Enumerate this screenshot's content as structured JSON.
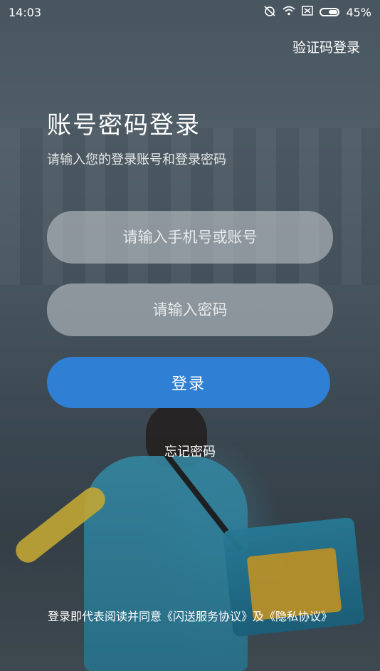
{
  "status_bar": {
    "time": "14:03",
    "icons": [
      "alarm-off-icon",
      "wifi-icon",
      "sim-off-icon",
      "battery-icon"
    ],
    "battery": "45%"
  },
  "header": {
    "switch_login_label": "验证码登录"
  },
  "main": {
    "title": "账号密码登录",
    "subtitle": "请输入您的登录账号和登录密码",
    "account_placeholder": "请输入手机号或账号",
    "password_placeholder": "请输入密码",
    "login_button": "登录",
    "forgot_password": "忘记密码"
  },
  "footer": {
    "agreement_prefix": "登录即代表阅读并同意",
    "service_agreement": "《闪送服务协议》",
    "connector": "及",
    "privacy_agreement": "《隐私协议》"
  },
  "colors": {
    "primary_button": "#2f7fd4",
    "input_background": "rgba(200,205,210,0.55)"
  }
}
